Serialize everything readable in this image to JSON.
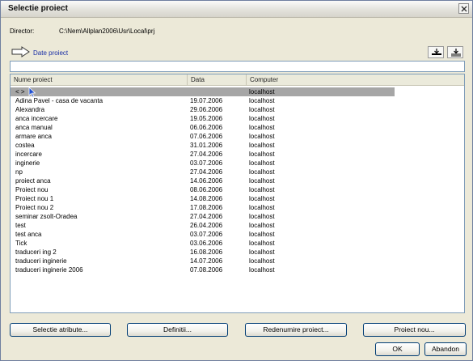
{
  "window": {
    "title": "Selectie proiect"
  },
  "directory": {
    "label": "Director:",
    "path": "C:\\Nem\\Allplan2006\\Usr\\Local\\prj"
  },
  "panel": {
    "label": "Date proiect",
    "filter_value": ""
  },
  "list": {
    "columns": [
      "Nume proiect",
      "Data",
      "Computer"
    ],
    "rows": [
      {
        "name": "< >",
        "date": "",
        "computer": "localhost"
      },
      {
        "name": "Adina Pavel - casa de vacanta",
        "date": "19.07.2006",
        "computer": "localhost"
      },
      {
        "name": "Alexandra",
        "date": "29.06.2006",
        "computer": "localhost"
      },
      {
        "name": "anca incercare",
        "date": "19.05.2006",
        "computer": "localhost"
      },
      {
        "name": "anca manual",
        "date": "06.06.2006",
        "computer": "localhost"
      },
      {
        "name": "armare anca",
        "date": "07.06.2006",
        "computer": "localhost"
      },
      {
        "name": "costea",
        "date": "31.01.2006",
        "computer": "localhost"
      },
      {
        "name": "incercare",
        "date": "27.04.2006",
        "computer": "localhost"
      },
      {
        "name": "inginerie",
        "date": "03.07.2006",
        "computer": "localhost"
      },
      {
        "name": "np",
        "date": "27.04.2006",
        "computer": "localhost"
      },
      {
        "name": "proiect anca",
        "date": "14.06.2006",
        "computer": "localhost"
      },
      {
        "name": "Proiect nou",
        "date": "08.06.2006",
        "computer": "localhost"
      },
      {
        "name": "Proiect nou 1",
        "date": "14.08.2006",
        "computer": "localhost"
      },
      {
        "name": "Proiect nou 2",
        "date": "17.08.2006",
        "computer": "localhost"
      },
      {
        "name": "seminar zsolt-Oradea",
        "date": "27.04.2006",
        "computer": "localhost"
      },
      {
        "name": "test",
        "date": "26.04.2006",
        "computer": "localhost"
      },
      {
        "name": "test anca",
        "date": "03.07.2006",
        "computer": "localhost"
      },
      {
        "name": "Tick",
        "date": "03.06.2006",
        "computer": "localhost"
      },
      {
        "name": "traduceri ing 2",
        "date": "16.08.2006",
        "computer": "localhost"
      },
      {
        "name": "traduceri inginerie",
        "date": "14.07.2006",
        "computer": "localhost"
      },
      {
        "name": "traduceri inginerie 2006",
        "date": "07.08.2006",
        "computer": "localhost"
      }
    ]
  },
  "buttons": {
    "select_attributes": "Selectie atribute...",
    "definitions": "Definitii...",
    "rename_project": "Redenumire proiect...",
    "new_project": "Proiect nou...",
    "ok": "OK",
    "cancel": "Abandon"
  },
  "icons": {
    "close": "close-icon",
    "panel_arrow": "arrow-right-icon",
    "expand": "expand-all-icon",
    "collapse": "collapse-all-icon"
  }
}
